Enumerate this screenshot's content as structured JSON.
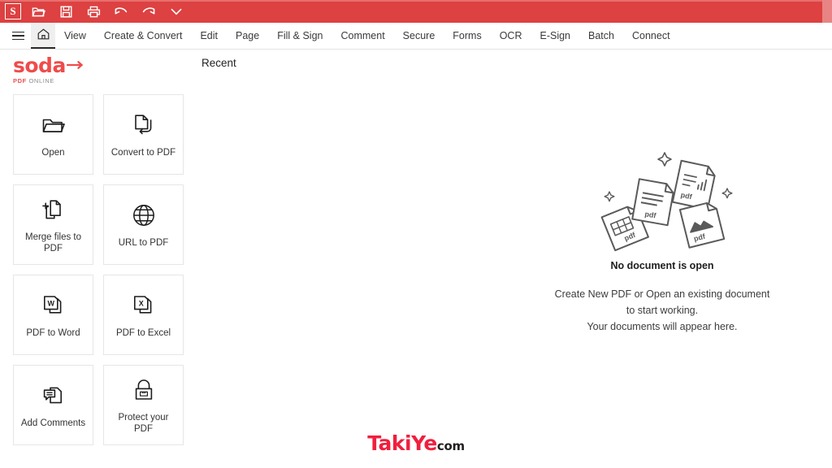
{
  "quickbar": {
    "app_badge": "S",
    "accent_color": "#dd4141",
    "buttons": [
      {
        "name": "open-icon",
        "title": "Open"
      },
      {
        "name": "save-icon",
        "title": "Save"
      },
      {
        "name": "print-icon",
        "title": "Print"
      },
      {
        "name": "undo-icon",
        "title": "Undo"
      },
      {
        "name": "redo-icon",
        "title": "Redo"
      },
      {
        "name": "chevron-down-icon",
        "title": "More"
      }
    ]
  },
  "menubar": {
    "items": [
      {
        "label": "View"
      },
      {
        "label": "Create & Convert"
      },
      {
        "label": "Edit"
      },
      {
        "label": "Page"
      },
      {
        "label": "Fill & Sign"
      },
      {
        "label": "Comment"
      },
      {
        "label": "Secure"
      },
      {
        "label": "Forms"
      },
      {
        "label": "OCR"
      },
      {
        "label": "E-Sign"
      },
      {
        "label": "Batch"
      },
      {
        "label": "Connect"
      }
    ]
  },
  "brand": {
    "name": "soda",
    "sub_pdf": "PDF",
    "sub_online": "ONLINE",
    "color": "#ef4b4b"
  },
  "recent": {
    "title": "Recent"
  },
  "tiles": [
    {
      "label": "Open",
      "icon": "folder-open-icon"
    },
    {
      "label": "Convert to PDF",
      "icon": "convert-to-pdf-icon"
    },
    {
      "label": "Merge files to PDF",
      "icon": "merge-files-icon"
    },
    {
      "label": "URL to PDF",
      "icon": "globe-icon"
    },
    {
      "label": "PDF to Word",
      "icon": "word-document-icon"
    },
    {
      "label": "PDF to Excel",
      "icon": "excel-document-icon"
    },
    {
      "label": "Add Comments",
      "icon": "comment-document-icon"
    },
    {
      "label": "Protect your PDF",
      "icon": "padlock-icon"
    }
  ],
  "empty_state": {
    "title": "No document is open",
    "line1": "Create New PDF or Open an existing document",
    "line2": "to start working.",
    "line3": "Your documents will appear here.",
    "art_labels": [
      "pdf",
      "pdf",
      "pdf",
      "pdf"
    ]
  },
  "watermark": {
    "main": "TakiYe",
    "sub": "com",
    "main_color": "#f01f3e",
    "sub_color": "#231f20"
  }
}
